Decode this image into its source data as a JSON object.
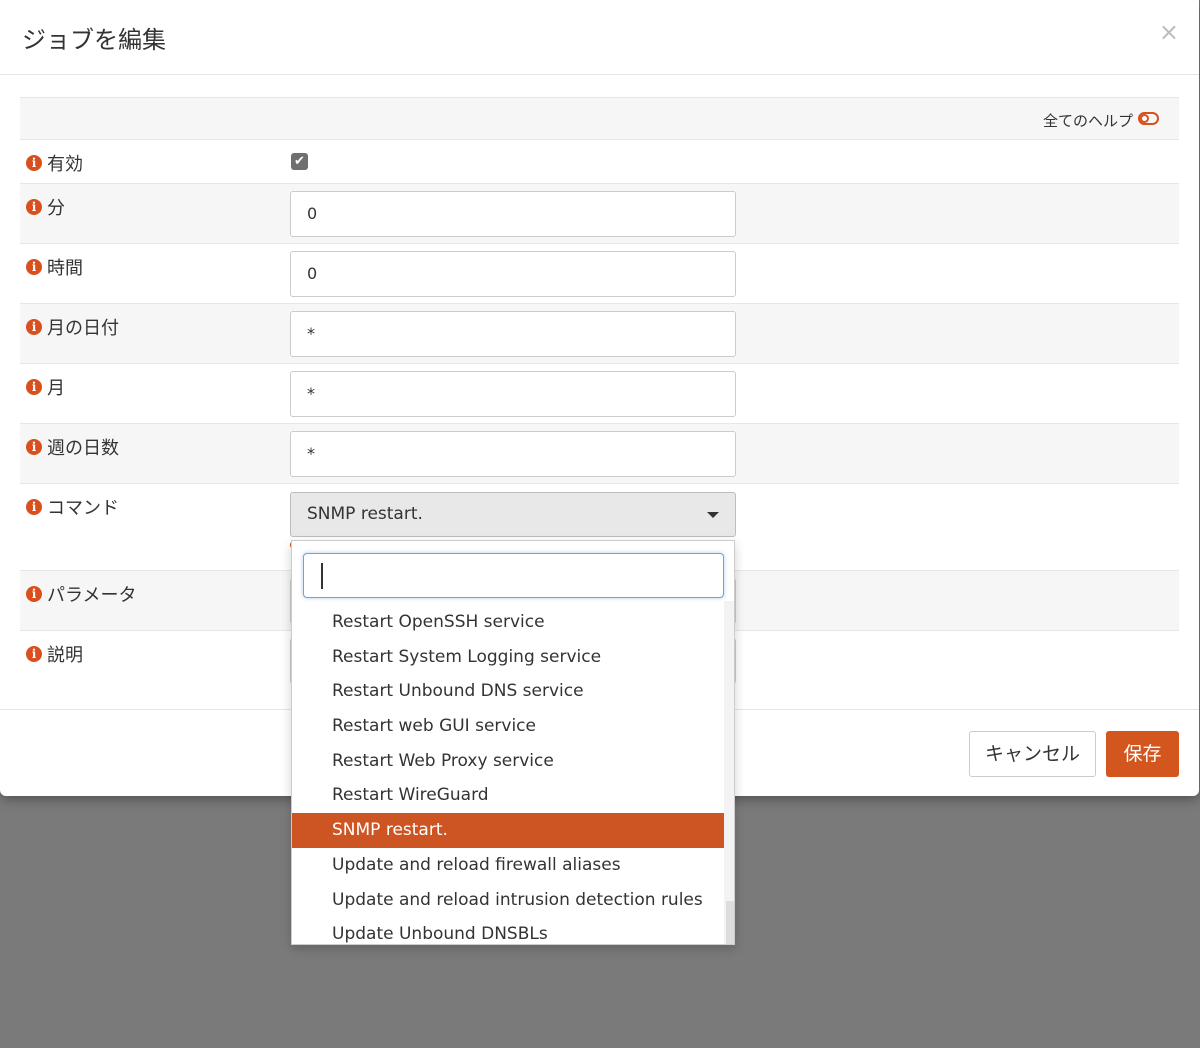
{
  "modal": {
    "title": "ジョブを編集",
    "close_symbol": "×",
    "help": {
      "label": "全てのヘルプ"
    }
  },
  "form": {
    "enabled": {
      "label": "有効",
      "checked": true
    },
    "minutes": {
      "label": "分",
      "value": "0"
    },
    "hours": {
      "label": "時間",
      "value": "0"
    },
    "day_of_month": {
      "label": "月の日付",
      "value": "*"
    },
    "month": {
      "label": "月",
      "value": "*"
    },
    "day_of_week": {
      "label": "週の日数",
      "value": "*"
    },
    "command": {
      "label": "コマンド",
      "selected": "SNMP restart."
    },
    "parameters": {
      "label": "パラメータ"
    },
    "description": {
      "label": "説明"
    }
  },
  "dropdown": {
    "search_value": "",
    "options": [
      "Restart OpenSSH service",
      "Restart System Logging service",
      "Restart Unbound DNS service",
      "Restart web GUI service",
      "Restart Web Proxy service",
      "Restart WireGuard",
      "SNMP restart.",
      "Update and reload firewall aliases",
      "Update and reload intrusion detection rules",
      "Update Unbound DNSBLs"
    ],
    "active_index": 6
  },
  "footer": {
    "cancel_label": "キャンセル",
    "save_label": "保存"
  },
  "colors": {
    "accent": "#d4561f",
    "overlay": "#7a7a7a"
  },
  "icons": {
    "info": "info-icon",
    "close": "close-icon",
    "caret": "caret-down-icon",
    "check": "checkmark-icon"
  }
}
